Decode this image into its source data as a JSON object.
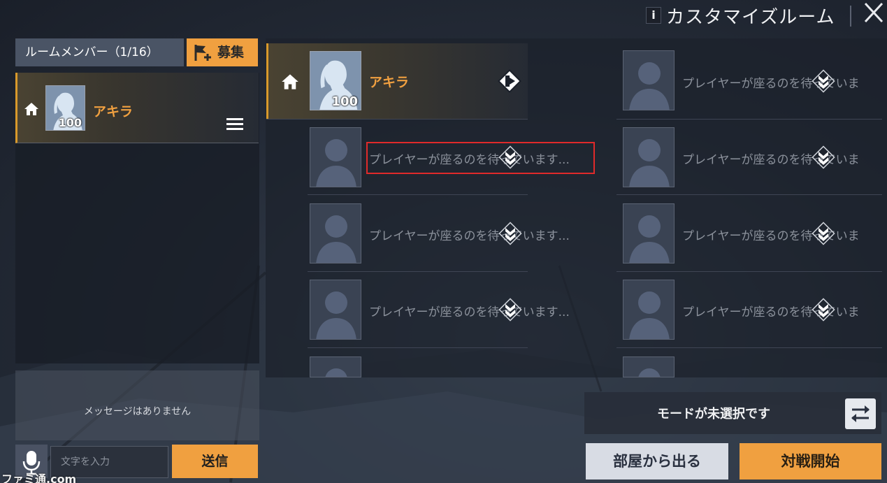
{
  "header": {
    "info_label": "i",
    "title": "カスタマイズルーム"
  },
  "left_panel": {
    "members_tab": "ルームメンバー（1/16）",
    "recruit_label": "募集",
    "members": [
      {
        "name": "アキラ",
        "level": "100"
      }
    ],
    "message_empty": "メッセージはありません",
    "input_placeholder": "文字を入力",
    "send_label": "送信"
  },
  "slots": {
    "owner": {
      "name": "アキラ",
      "level": "100"
    },
    "waiting_text": "プレイヤーが座るのを待っています...",
    "waiting_text_clipped": "プレイヤーが座るのを待っていま"
  },
  "footer": {
    "mode_text": "モードが未選択です",
    "leave_label": "部屋から出る",
    "start_label": "対戦開始"
  },
  "watermark": "ファミ通.com",
  "colors": {
    "accent": "#f0a040",
    "highlight": "#e02a2a"
  }
}
